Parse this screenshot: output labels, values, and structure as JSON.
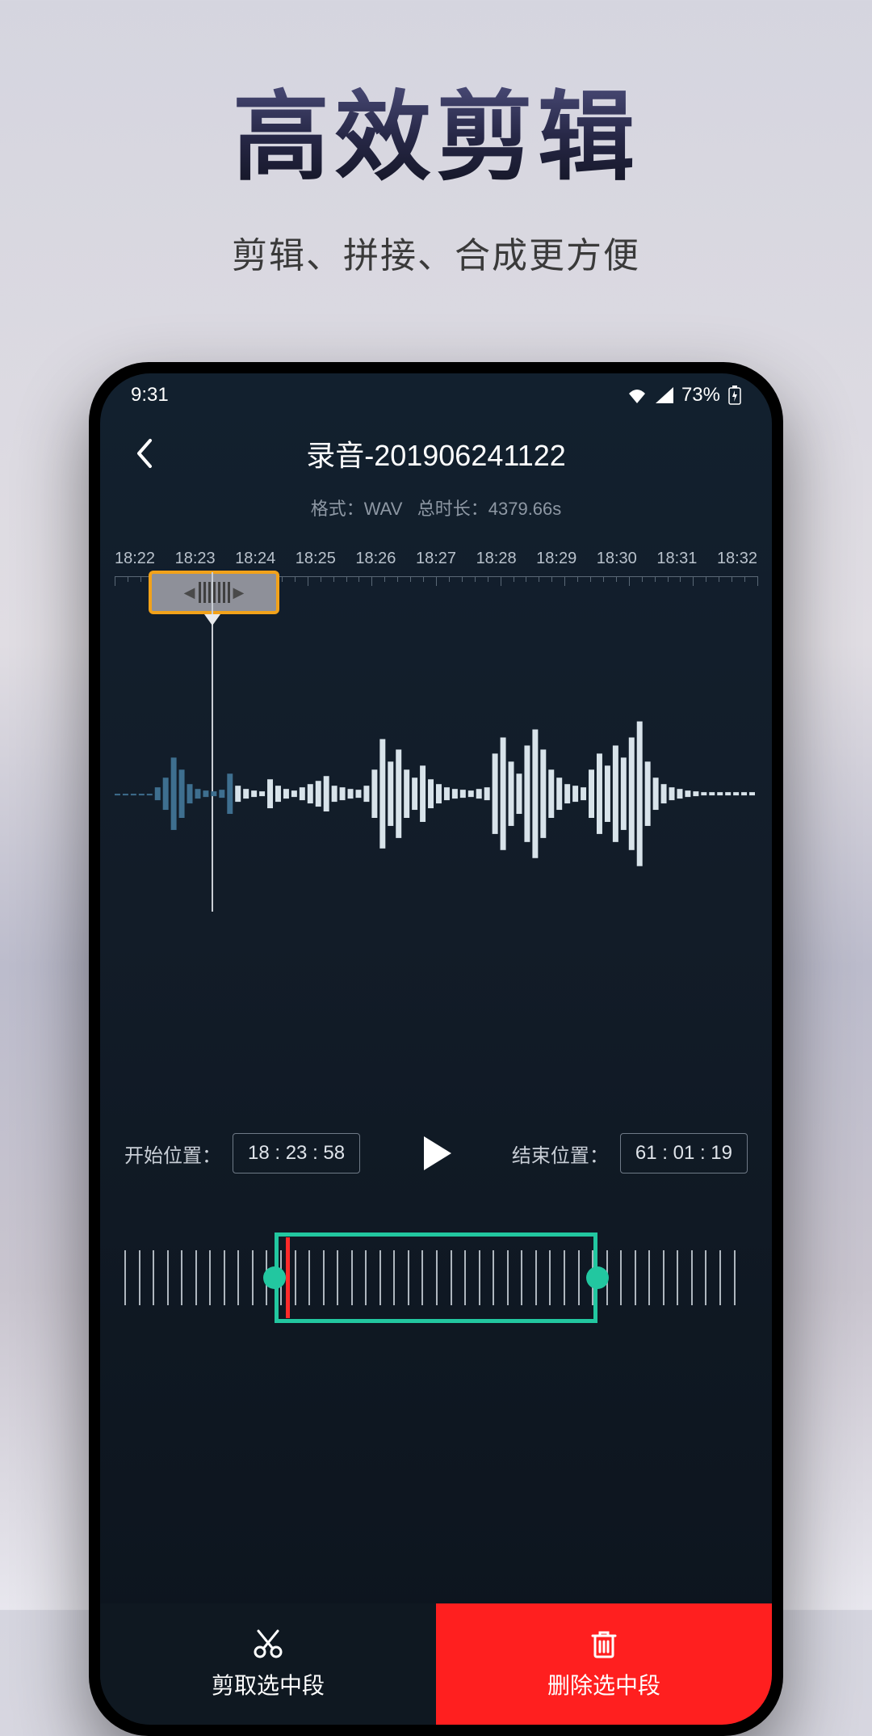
{
  "hero": {
    "title": "高效剪辑",
    "subtitle": "剪辑、拼接、合成更方便"
  },
  "status": {
    "time": "9:31",
    "battery": "73%"
  },
  "nav": {
    "title": "录音-201906241122"
  },
  "meta": {
    "format_label": "格式：",
    "format": "WAV",
    "duration_label": "总时长：",
    "duration": "4379.66s"
  },
  "timeline": {
    "ticks": [
      "18:22",
      "18:23",
      "18:24",
      "18:25",
      "18:26",
      "18:27",
      "18:28",
      "18:29",
      "18:30",
      "18:31",
      "18:32"
    ]
  },
  "controls": {
    "start_label": "开始位置：",
    "start_value": "18 : 23 : 58",
    "end_label": "结束位置：",
    "end_value": "61 : 01 : 19"
  },
  "actions": {
    "cut": "剪取选中段",
    "delete": "删除选中段"
  }
}
